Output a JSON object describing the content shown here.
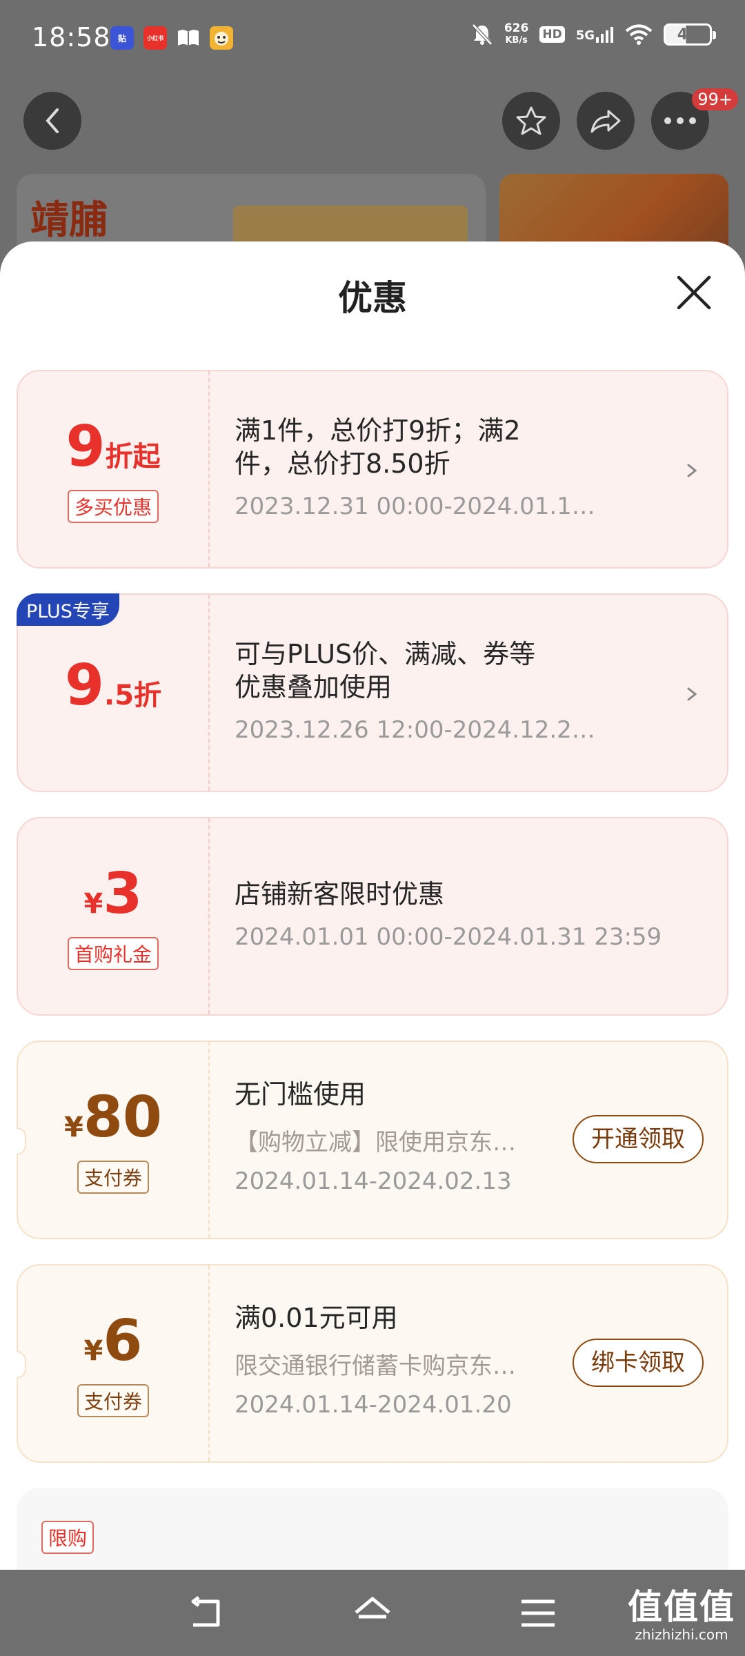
{
  "status_bar": {
    "time": "18:58",
    "net_speed_value": "626",
    "net_speed_unit": "KB/s",
    "hd": "HD",
    "network": "5G",
    "battery": "46",
    "app_icons": [
      {
        "name": "tiezhi-app-icon",
        "label": "贴",
        "color": "#3b55d6"
      },
      {
        "name": "xiaohongshu-app-icon",
        "label": "小红书",
        "color": "#e8312a"
      },
      {
        "name": "book-app-icon",
        "label": "",
        "color": "#ffffff"
      },
      {
        "name": "emoji-app-icon",
        "label": "",
        "color": "#f2b232"
      }
    ]
  },
  "background_page": {
    "more_badge": "99+",
    "brand": "靖脯"
  },
  "sheet": {
    "title": "优惠",
    "coupons": [
      {
        "value_big": "9",
        "value_unit": "折起",
        "tag": "多买优惠",
        "description": "满1件，总价打9折；满2件，总价打8.50折",
        "description_lines": [
          "满1件，总价打9折；满2",
          "件，总价打8.50折"
        ],
        "period": "2023.12.31 00:00-2024.01.1…"
      },
      {
        "badge": "PLUS专享",
        "value_big": "9",
        "value_unit": ".5折",
        "description_lines": [
          "可与PLUS价、满减、券等",
          "优惠叠加使用"
        ],
        "period": "2023.12.26 12:00-2024.12.2…"
      },
      {
        "currency": "¥",
        "value_big": "3",
        "tag": "首购礼金",
        "description_lines": [
          "店铺新客限时优惠"
        ],
        "period": "2024.01.01 00:00-2024.01.31 23:59"
      },
      {
        "currency": "¥",
        "value_big": "80",
        "tag": "支付券",
        "description_lines": [
          "无门槛使用"
        ],
        "note": "【购物立减】限使用京东…",
        "period": "2024.01.14-2024.02.13",
        "action": "开通领取"
      },
      {
        "currency": "¥",
        "value_big": "6",
        "tag": "支付券",
        "description_lines": [
          "满0.01元可用"
        ],
        "note": "限交通银行储蓄卡购京东…",
        "period": "2024.01.14-2024.01.20",
        "action": "绑卡领取"
      }
    ],
    "limit_tag": "限购"
  },
  "watermark": {
    "title": "值值值",
    "site": "zhizhizhi.com"
  },
  "colors": {
    "red": "#e8312a",
    "brown": "#8f4a10",
    "plus_blue": "#2345b5"
  }
}
